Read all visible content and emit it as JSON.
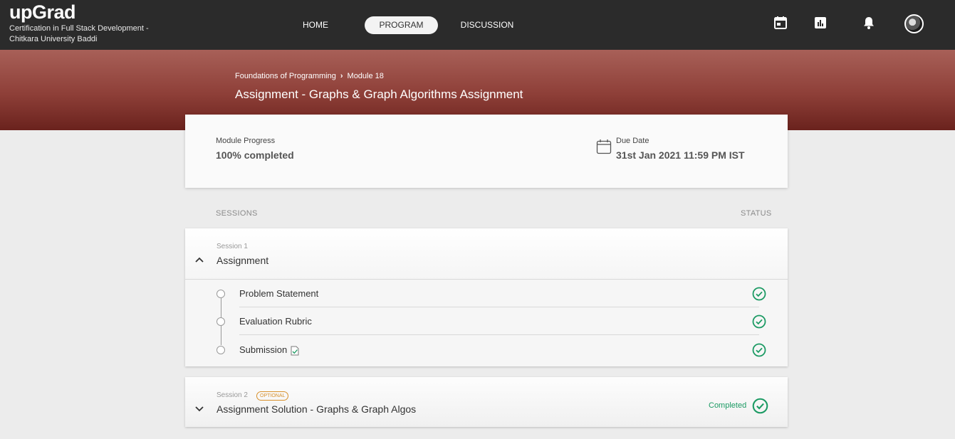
{
  "header": {
    "logo": "upGrad",
    "program_title": "Certification in Full Stack Development - Chitkara University Baddi",
    "nav": [
      "HOME",
      "PROGRAM",
      "DISCUSSION"
    ],
    "active_nav": "PROGRAM",
    "icons": [
      "calendar-icon",
      "leaderboard-icon",
      "bell-icon",
      "avatar"
    ]
  },
  "breadcrumb": [
    "Foundations of Programming",
    "Module 18"
  ],
  "page_title": "Assignment - Graphs & Graph Algorithms Assignment",
  "progress": {
    "module_progress_label": "Module Progress",
    "module_progress_value": "100% completed",
    "due_date_label": "Due Date",
    "due_date_value": "31st Jan 2021 11:59 PM IST"
  },
  "columns": {
    "sessions": "SESSIONS",
    "status": "STATUS"
  },
  "sessions": [
    {
      "number": "Session 1",
      "name": "Assignment",
      "expanded": true,
      "items": [
        {
          "label": "Problem Statement",
          "status": "complete"
        },
        {
          "label": "Evaluation Rubric",
          "status": "complete"
        },
        {
          "label": "Submission",
          "status": "complete",
          "icon": "document-check-icon"
        }
      ]
    },
    {
      "number": "Session 2",
      "badge": "OPTIONAL",
      "name": "Assignment Solution - Graphs & Graph Algos",
      "expanded": false,
      "status_text": "Completed"
    }
  ],
  "colors": {
    "accent_green": "#1b9a63",
    "banner": "#8e3f38",
    "optional_badge": "#d7902b",
    "topbar": "#2b2b2b"
  }
}
